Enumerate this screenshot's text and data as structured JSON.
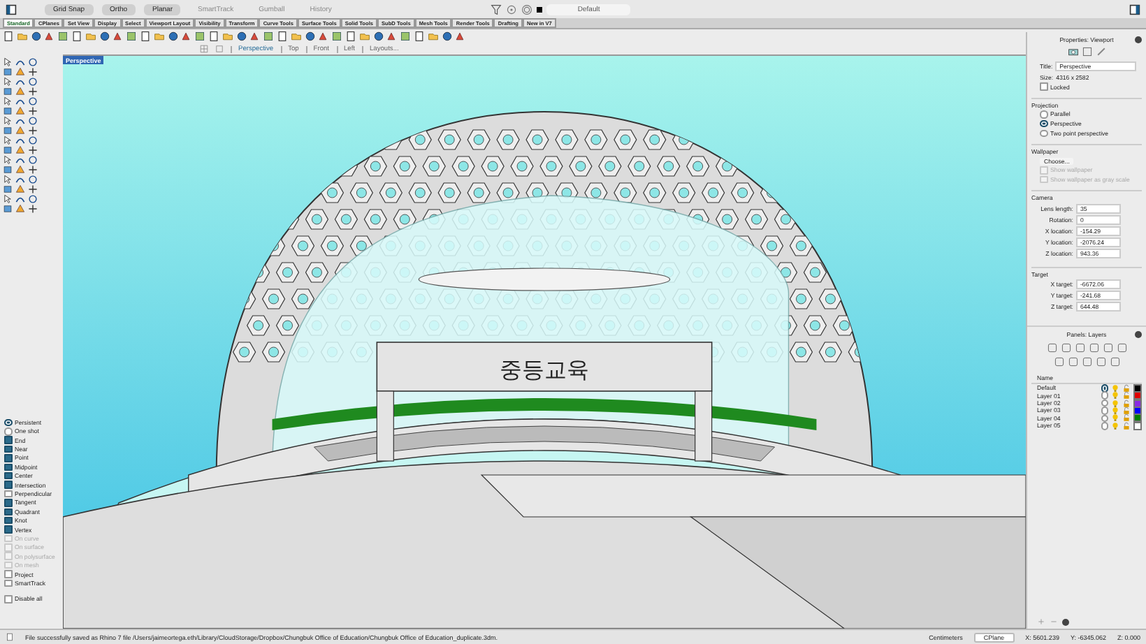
{
  "top_bar": {
    "modes": [
      {
        "label": "Grid Snap",
        "on": true
      },
      {
        "label": "Ortho",
        "on": true
      },
      {
        "label": "Planar",
        "on": true
      },
      {
        "label": "SmartTrack",
        "on": false
      },
      {
        "label": "Gumball",
        "on": false
      },
      {
        "label": "History",
        "on": false
      }
    ],
    "layer": "Default"
  },
  "toolbar_tabs": [
    {
      "label": "Standard",
      "selected": true
    },
    {
      "label": "CPlanes",
      "selected": false
    },
    {
      "label": "Set View",
      "selected": false
    },
    {
      "label": "Display",
      "selected": false
    },
    {
      "label": "Select",
      "selected": false
    },
    {
      "label": "Viewport Layout",
      "selected": false
    },
    {
      "label": "Visibility",
      "selected": false
    },
    {
      "label": "Transform",
      "selected": false
    },
    {
      "label": "Curve Tools",
      "selected": false
    },
    {
      "label": "Surface Tools",
      "selected": false
    },
    {
      "label": "Solid Tools",
      "selected": false
    },
    {
      "label": "SubD Tools",
      "selected": false
    },
    {
      "label": "Mesh Tools",
      "selected": false
    },
    {
      "label": "Render Tools",
      "selected": false
    },
    {
      "label": "Drafting",
      "selected": false
    },
    {
      "label": "New in V7",
      "selected": false
    }
  ],
  "viewport_tabs": [
    {
      "label": "Perspective",
      "selected": true
    },
    {
      "label": "Top",
      "selected": false
    },
    {
      "label": "Front",
      "selected": false
    },
    {
      "label": "Left",
      "selected": false
    },
    {
      "label": "Layouts...",
      "selected": false
    }
  ],
  "viewport": {
    "label": "Perspective",
    "sign_text": "중등교육"
  },
  "osnap": {
    "modes": [
      {
        "label": "Persistent",
        "selected": true
      },
      {
        "label": "One shot",
        "selected": false
      }
    ],
    "items": [
      {
        "label": "End",
        "checked": true,
        "disabled": false
      },
      {
        "label": "Near",
        "checked": true,
        "disabled": false
      },
      {
        "label": "Point",
        "checked": true,
        "disabled": false
      },
      {
        "label": "Midpoint",
        "checked": true,
        "disabled": false
      },
      {
        "label": "Center",
        "checked": true,
        "disabled": false
      },
      {
        "label": "Intersection",
        "checked": true,
        "disabled": false
      },
      {
        "label": "Perpendicular",
        "checked": false,
        "disabled": false
      },
      {
        "label": "Tangent",
        "checked": true,
        "disabled": false
      },
      {
        "label": "Quadrant",
        "checked": true,
        "disabled": false
      },
      {
        "label": "Knot",
        "checked": true,
        "disabled": false
      },
      {
        "label": "Vertex",
        "checked": true,
        "disabled": false
      },
      {
        "label": "On curve",
        "checked": false,
        "disabled": true
      },
      {
        "label": "On surface",
        "checked": false,
        "disabled": true
      },
      {
        "label": "On polysurface",
        "checked": false,
        "disabled": true
      },
      {
        "label": "On mesh",
        "checked": false,
        "disabled": true
      },
      {
        "label": "Project",
        "checked": false,
        "disabled": false
      },
      {
        "label": "SmartTrack",
        "checked": false,
        "disabled": false
      }
    ],
    "disable_all": {
      "label": "Disable all",
      "checked": false
    }
  },
  "properties": {
    "title": "Properties: Viewport",
    "title_field": {
      "label": "Title:",
      "value": "Perspective"
    },
    "size": {
      "label": "Size:",
      "value": "4316 x 2582"
    },
    "locked": {
      "label": "Locked",
      "checked": false
    },
    "projection": {
      "heading": "Projection",
      "options": [
        {
          "label": "Parallel",
          "selected": false
        },
        {
          "label": "Perspective",
          "selected": true
        },
        {
          "label": "Two point perspective",
          "selected": false
        }
      ]
    },
    "wallpaper": {
      "heading": "Wallpaper",
      "button": "Choose...",
      "options": [
        {
          "label": "Show wallpaper",
          "checked": false,
          "disabled": true
        },
        {
          "label": "Show wallpaper as gray scale",
          "checked": false,
          "disabled": true
        }
      ]
    },
    "camera": {
      "heading": "Camera",
      "fields": [
        {
          "label": "Lens length:",
          "value": "35"
        },
        {
          "label": "Rotation:",
          "value": "0"
        },
        {
          "label": "X location:",
          "value": "-154.29"
        },
        {
          "label": "Y location:",
          "value": "-2076.24"
        },
        {
          "label": "Z location:",
          "value": "943.36"
        }
      ]
    },
    "target": {
      "heading": "Target",
      "fields": [
        {
          "label": "X target:",
          "value": "-6672.06"
        },
        {
          "label": "Y target:",
          "value": "-241.68"
        },
        {
          "label": "Z target:",
          "value": "644.48"
        }
      ]
    }
  },
  "layers": {
    "title": "Panels: Layers",
    "column": "Name",
    "rows": [
      {
        "name": "Default",
        "current": true,
        "color": "#000000"
      },
      {
        "name": "Layer 01",
        "current": false,
        "color": "#e00000"
      },
      {
        "name": "Layer 02",
        "current": false,
        "color": "#8a2be2"
      },
      {
        "name": "Layer 03",
        "current": false,
        "color": "#0000ff"
      },
      {
        "name": "Layer 04",
        "current": false,
        "color": "#008000"
      },
      {
        "name": "Layer 05",
        "current": false,
        "color": "#ffffff"
      }
    ]
  },
  "status_bar": {
    "message": "File successfully saved as Rhino 7 file /Users/jaimeortega.eth/Library/CloudStorage/Dropbox/Chungbuk Office of Education/Chungbuk Office of Education_duplicate.3dm.",
    "units": "Centimeters",
    "cplane": "CPlane",
    "x": "X: 5601.239",
    "y": "Y: -6345.062",
    "z": "Z: 0.000"
  }
}
